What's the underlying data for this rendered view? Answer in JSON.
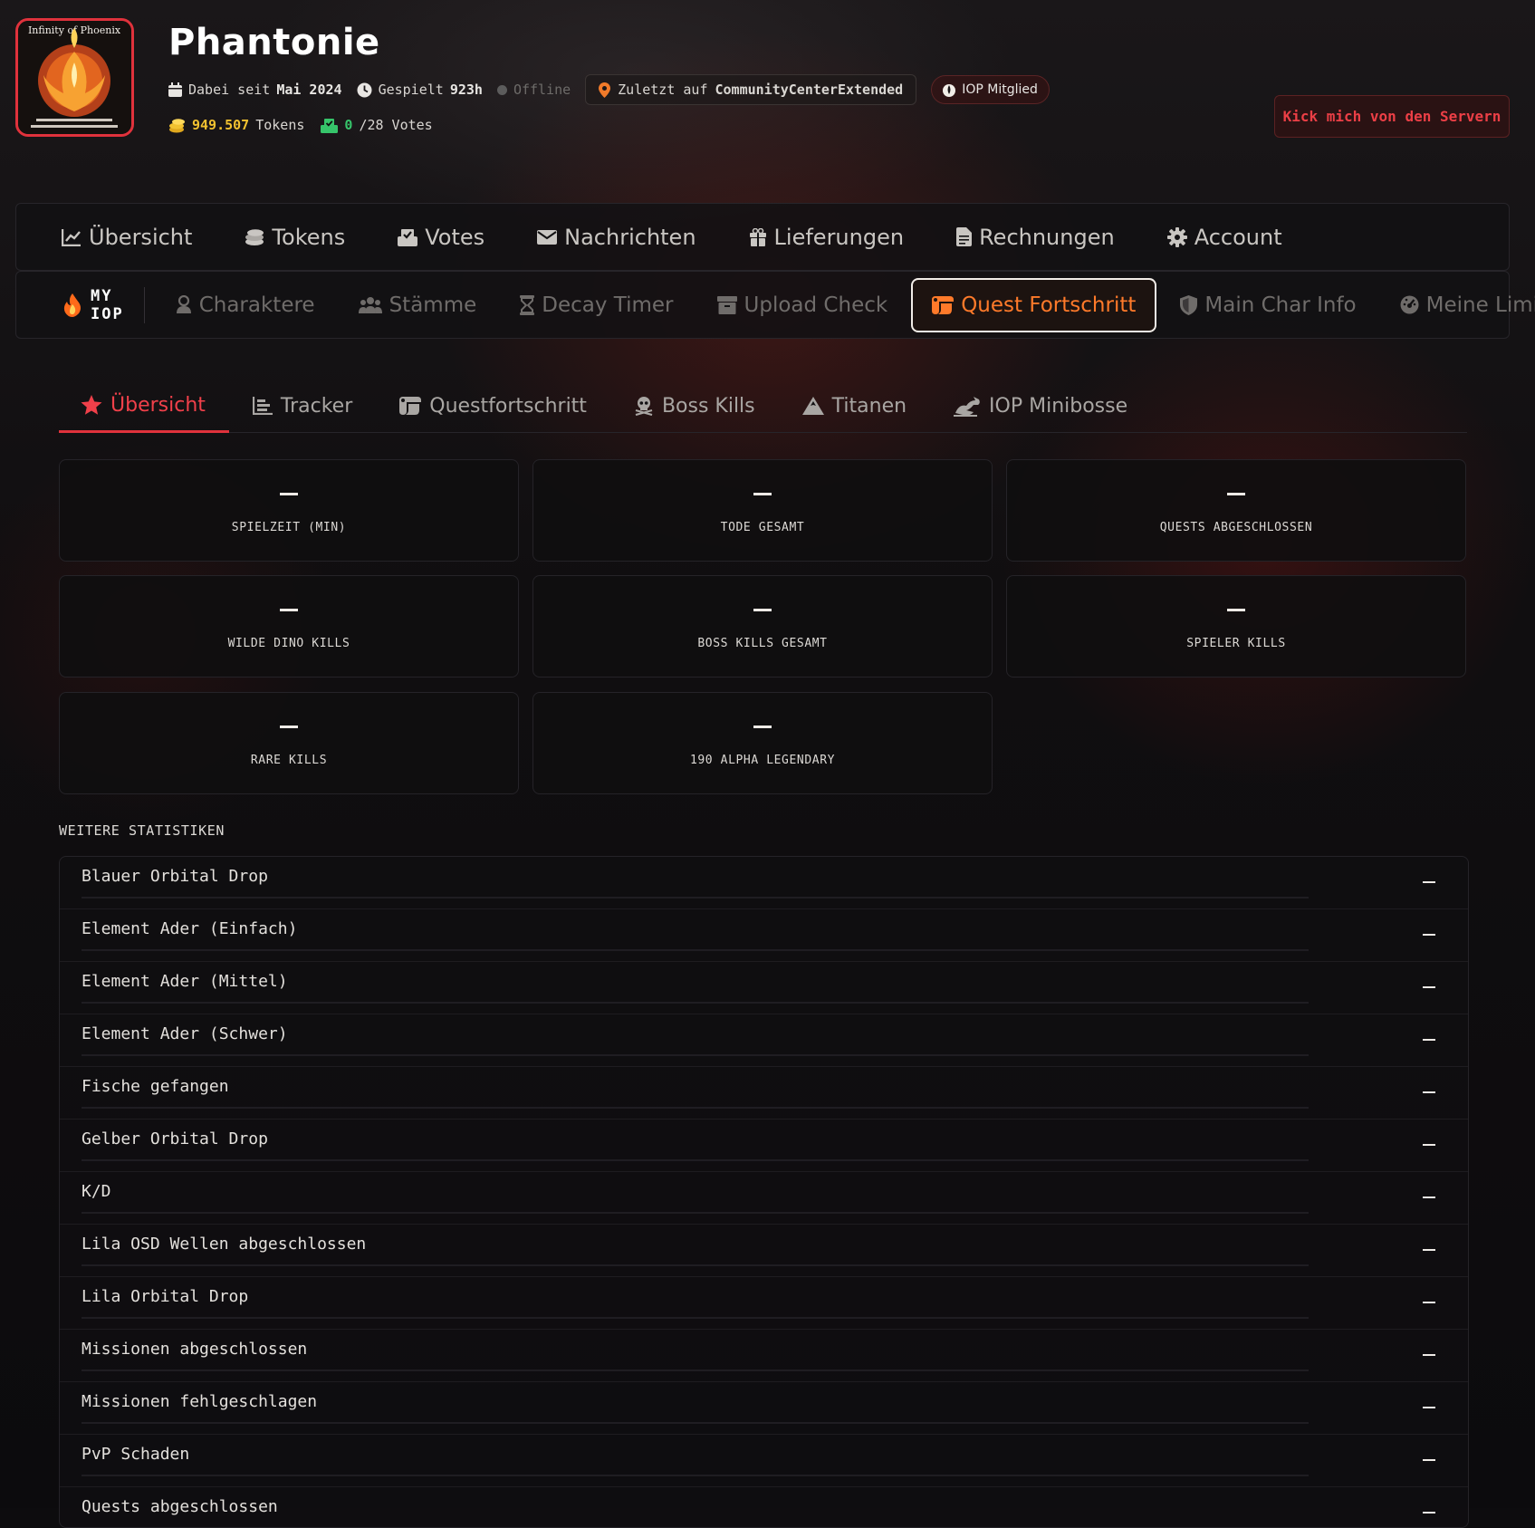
{
  "header": {
    "logo": {
      "top_text": "Infinity of Phoenix"
    },
    "username": "Phantonie",
    "member_since_label": "Dabei seit",
    "member_since_value": "Mai 2024",
    "played_label": "Gespielt",
    "played_value": "923h",
    "status": "Offline",
    "last_seen_label": "Zuletzt auf",
    "last_seen_server": "CommunityCenterExtended",
    "member_badge": "IOP Mitglied",
    "tokens_value": "949.507",
    "tokens_label": "Tokens",
    "votes_value": "0",
    "votes_suffix": "/28 Votes",
    "kick_button": "Kick mich von den Servern"
  },
  "main_nav": {
    "items": [
      {
        "label": "Übersicht",
        "icon": "chart-line-icon"
      },
      {
        "label": "Tokens",
        "icon": "coins-icon"
      },
      {
        "label": "Votes",
        "icon": "vote-box-icon"
      },
      {
        "label": "Nachrichten",
        "icon": "envelope-icon"
      },
      {
        "label": "Lieferungen",
        "icon": "gift-icon"
      },
      {
        "label": "Rechnungen",
        "icon": "invoice-icon"
      },
      {
        "label": "Account",
        "icon": "gear-icon"
      }
    ]
  },
  "sub_nav": {
    "brand": "MY IOP",
    "items": [
      {
        "label": "Charaktere",
        "icon": "user-icon"
      },
      {
        "label": "Stämme",
        "icon": "users-icon"
      },
      {
        "label": "Decay Timer",
        "icon": "hourglass-icon"
      },
      {
        "label": "Upload Check",
        "icon": "archive-icon"
      },
      {
        "label": "Quest Fortschritt",
        "icon": "scroll-icon",
        "active": true
      },
      {
        "label": "Main Char Info",
        "icon": "shield-icon"
      },
      {
        "label": "Meine Limits",
        "icon": "gauge-icon"
      }
    ]
  },
  "tabs": {
    "items": [
      {
        "label": "Übersicht",
        "icon": "star-icon",
        "active": true
      },
      {
        "label": "Tracker",
        "icon": "bars-icon"
      },
      {
        "label": "Questfortschritt",
        "icon": "scroll-icon"
      },
      {
        "label": "Boss Kills",
        "icon": "skull-icon"
      },
      {
        "label": "Titanen",
        "icon": "mountain-icon"
      },
      {
        "label": "IOP Minibosse",
        "icon": "dragon-icon"
      }
    ]
  },
  "stats": {
    "cards": [
      {
        "label": "SPIELZEIT (MIN)",
        "value": "–"
      },
      {
        "label": "TODE GESAMT",
        "value": "–"
      },
      {
        "label": "QUESTS ABGESCHLOSSEN",
        "value": "–"
      },
      {
        "label": "WILDE DINO KILLS",
        "value": "–"
      },
      {
        "label": "BOSS KILLS GESAMT",
        "value": "–"
      },
      {
        "label": "SPIELER KILLS",
        "value": "–"
      },
      {
        "label": "RARE KILLS",
        "value": "–"
      },
      {
        "label": "190 ALPHA LEGENDARY",
        "value": "–"
      }
    ]
  },
  "further": {
    "title": "WEITERE STATISTIKEN",
    "rows": [
      {
        "name": "Blauer Orbital Drop",
        "value": "–"
      },
      {
        "name": "Element Ader (Einfach)",
        "value": "–"
      },
      {
        "name": "Element Ader (Mittel)",
        "value": "–"
      },
      {
        "name": "Element Ader (Schwer)",
        "value": "–"
      },
      {
        "name": "Fische gefangen",
        "value": "–"
      },
      {
        "name": "Gelber Orbital Drop",
        "value": "–"
      },
      {
        "name": "K/D",
        "value": "–"
      },
      {
        "name": "Lila OSD Wellen abgeschlossen",
        "value": "–"
      },
      {
        "name": "Lila Orbital Drop",
        "value": "–"
      },
      {
        "name": "Missionen abgeschlossen",
        "value": "–"
      },
      {
        "name": "Missionen fehlgeschlagen",
        "value": "–"
      },
      {
        "name": "PvP Schaden",
        "value": "–"
      },
      {
        "name": "Quests abgeschlossen",
        "value": "–"
      }
    ]
  },
  "colors": {
    "accent_red": "#e0323c",
    "accent_orange": "#ff7a2a",
    "gold": "#f2c230",
    "green": "#36c46a",
    "background": "#0d0c0e"
  }
}
